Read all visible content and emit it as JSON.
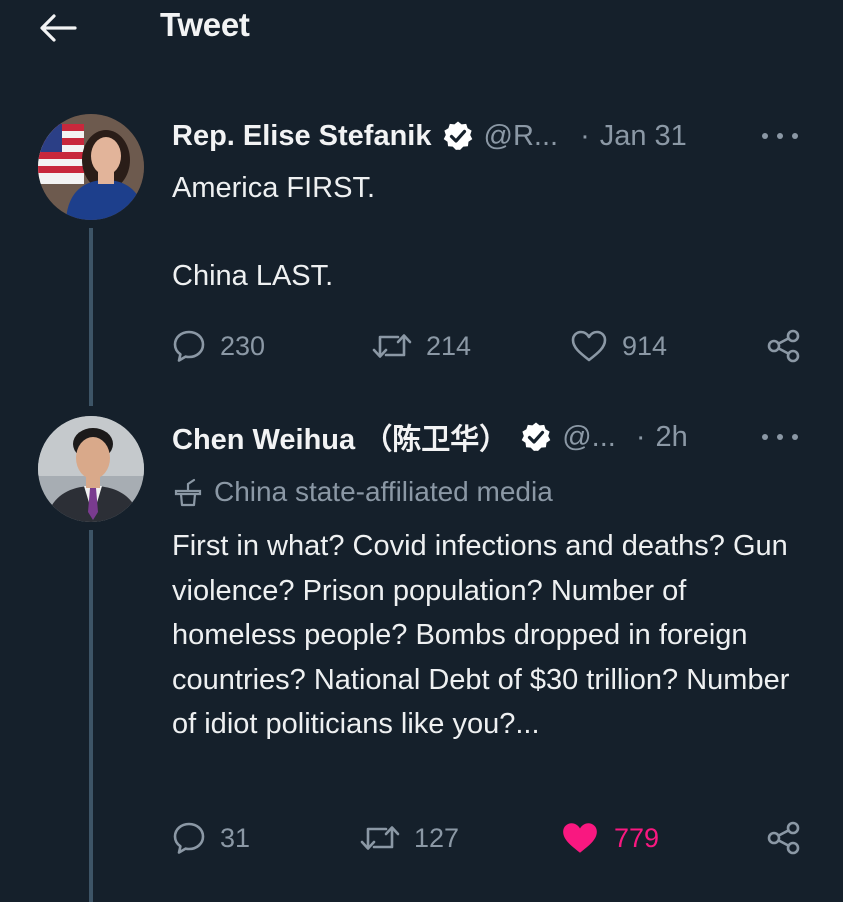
{
  "header": {
    "title": "Tweet"
  },
  "tweets": [
    {
      "author": "Rep. Elise Stefanik",
      "handle": "@R...",
      "separator": "·",
      "time": "Jan 31",
      "lines": [
        "America FIRST.",
        "China LAST."
      ],
      "replies": "230",
      "retweets": "214",
      "likes": "914",
      "liked": false
    },
    {
      "author": "Chen Weihua （陈卫华）",
      "handle": "@...",
      "separator": "·",
      "time": "2h",
      "label": "China state-affiliated media",
      "text": "First in what? Covid infections and deaths? Gun violence? Prison population? Number of homeless people? Bombs dropped in foreign countries? National Debt of $30 trillion? Number of idiot politicians like you?...",
      "replies": "31",
      "retweets": "127",
      "likes": "779",
      "liked": true
    }
  ],
  "colors": {
    "background": "#15202b",
    "muted": "#8b98a5",
    "like_active": "#f91880",
    "thread_line": "#3d5466"
  }
}
